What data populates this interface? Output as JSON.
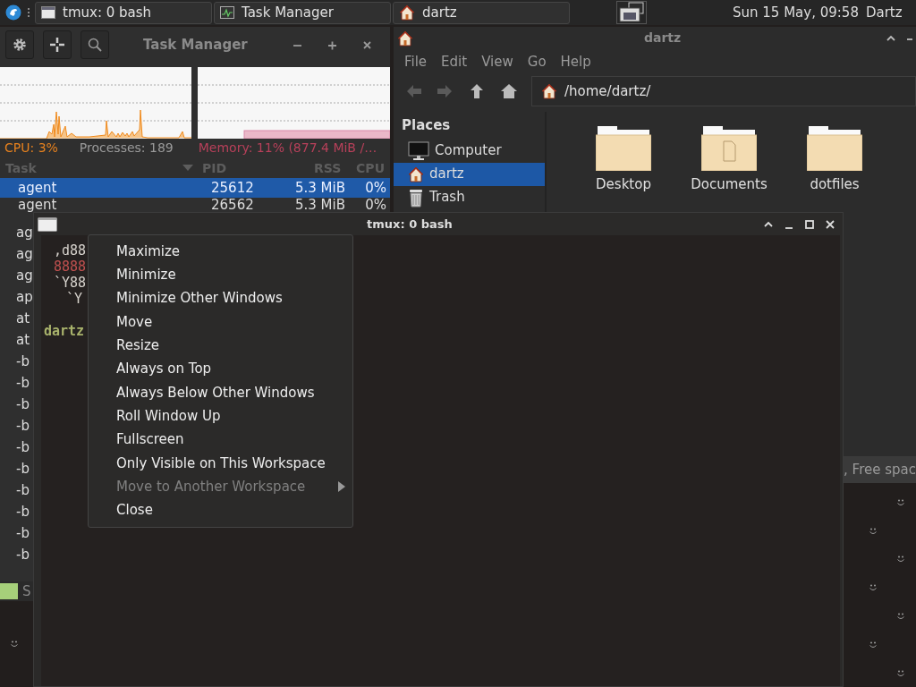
{
  "top_panel": {
    "taskbar": [
      {
        "label": "tmux: 0 bash",
        "selected": false
      },
      {
        "label": "Task Manager",
        "selected": false
      },
      {
        "label": "dartz",
        "selected": false
      }
    ],
    "clock": "Sun 15 May, 09:58",
    "user": "Dartz"
  },
  "task_manager": {
    "title": "Task Manager",
    "cpu": "CPU: 3%",
    "processes": "Processes: 189",
    "memory": "Memory: 11% (877.4 MiB /…",
    "columns": [
      "Task",
      "PID",
      "RSS",
      "CPU"
    ],
    "rows": [
      {
        "task": "agent",
        "pid": "25612",
        "rss": "5.3 MiB",
        "cpu": "0%",
        "selected": true
      },
      {
        "task": "agent",
        "pid": "26562",
        "rss": "5.3 MiB",
        "cpu": "0%",
        "selected": false
      },
      {
        "task": "ag",
        "selected": false
      },
      {
        "task": "ag",
        "selected": false
      },
      {
        "task": "ag",
        "selected": false
      },
      {
        "task": "ap",
        "selected": false
      },
      {
        "task": "at",
        "selected": false
      },
      {
        "task": "at",
        "selected": false
      },
      {
        "task": "-b",
        "selected": false
      },
      {
        "task": "-b",
        "selected": false
      },
      {
        "task": "-b",
        "selected": false
      },
      {
        "task": "-b",
        "selected": false
      },
      {
        "task": "-b",
        "selected": false
      },
      {
        "task": "-b",
        "selected": false
      },
      {
        "task": "-b",
        "selected": false
      },
      {
        "task": "-b",
        "selected": false
      },
      {
        "task": "-b",
        "selected": false
      },
      {
        "task": "-b",
        "selected": false
      }
    ],
    "status": "S"
  },
  "file_manager": {
    "title": "dartz",
    "menu": [
      "File",
      "Edit",
      "View",
      "Go",
      "Help"
    ],
    "location": "/home/dartz/",
    "places_heading": "Places",
    "places": [
      {
        "label": "Computer",
        "selected": false
      },
      {
        "label": "dartz",
        "selected": true
      },
      {
        "label": "Trash",
        "selected": false
      }
    ],
    "files": [
      {
        "name": "Desktop",
        "kind": "folder"
      },
      {
        "name": "Documents",
        "kind": "documents"
      },
      {
        "name": "dotfiles",
        "kind": "folder"
      }
    ],
    "status": ", Free spac"
  },
  "terminal": {
    "title": "tmux: 0 bash",
    "lines": [
      {
        "text": ",d88",
        "kind": "art",
        "color": "#d6d2cc"
      },
      {
        "text": "8888",
        "kind": "art",
        "color": "#c0504f"
      },
      {
        "text": "`Y88",
        "kind": "art",
        "color": "#d6d2cc"
      },
      {
        "text": "`Y",
        "kind": "art",
        "color": "#d6d2cc"
      },
      {
        "text": "dartz",
        "kind": "prompt",
        "color": "#a9b36c"
      }
    ]
  },
  "context_menu": {
    "items": [
      {
        "label": "Maximize",
        "disabled": false,
        "submenu": false
      },
      {
        "label": "Minimize",
        "disabled": false,
        "submenu": false
      },
      {
        "label": "Minimize Other Windows",
        "disabled": false,
        "submenu": false
      },
      {
        "label": "Move",
        "disabled": false,
        "submenu": false
      },
      {
        "label": "Resize",
        "disabled": false,
        "submenu": false
      },
      {
        "label": "Always on Top",
        "disabled": false,
        "submenu": false
      },
      {
        "label": "Always Below Other Windows",
        "disabled": false,
        "submenu": false
      },
      {
        "label": "Roll Window Up",
        "disabled": false,
        "submenu": false
      },
      {
        "label": "Fullscreen",
        "disabled": false,
        "submenu": false
      },
      {
        "label": "Only Visible on This Workspace",
        "disabled": false,
        "submenu": false
      },
      {
        "label": "Move to Another Workspace",
        "disabled": true,
        "submenu": true
      },
      {
        "label": "Close",
        "disabled": false,
        "submenu": false
      }
    ]
  }
}
